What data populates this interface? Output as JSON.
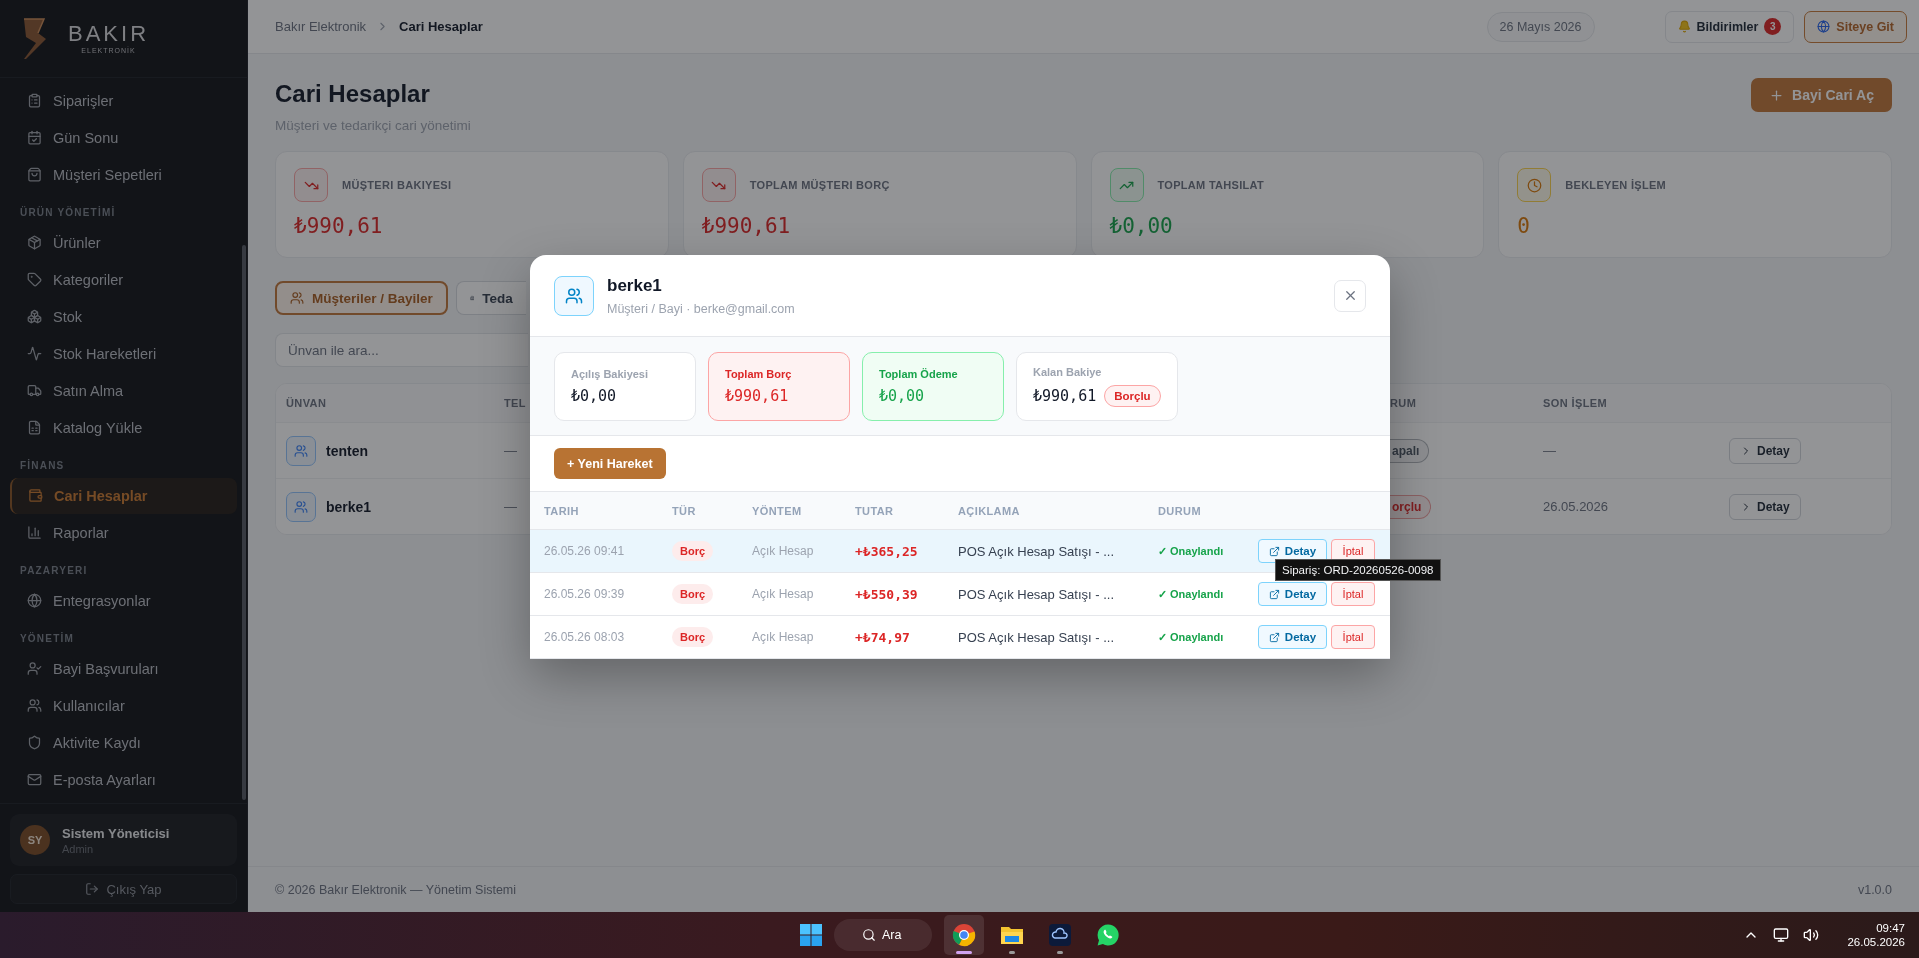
{
  "sidebar": {
    "brand": {
      "name": "BAKIR",
      "tagline": "ELEKTRONİK"
    },
    "sections": [
      {
        "items": [
          {
            "label": "Siparişler",
            "selected": false
          },
          {
            "label": "Gün Sonu",
            "selected": false
          },
          {
            "label": "Müşteri Sepetleri",
            "selected": false
          }
        ]
      },
      {
        "title": "ÜRÜN YÖNETİMİ",
        "items": [
          {
            "label": "Ürünler",
            "selected": false
          },
          {
            "label": "Kategoriler",
            "selected": false
          },
          {
            "label": "Stok",
            "selected": false
          },
          {
            "label": "Stok Hareketleri",
            "selected": false
          },
          {
            "label": "Satın Alma",
            "selected": false
          },
          {
            "label": "Katalog Yükle",
            "selected": false
          }
        ]
      },
      {
        "title": "FİNANS",
        "items": [
          {
            "label": "Cari Hesaplar",
            "selected": true
          },
          {
            "label": "Raporlar",
            "selected": false
          }
        ]
      },
      {
        "title": "PAZARYERI",
        "items": [
          {
            "label": "Entegrasyonlar",
            "selected": false
          }
        ]
      },
      {
        "title": "YÖNETİM",
        "items": [
          {
            "label": "Bayi Başvuruları",
            "selected": false
          },
          {
            "label": "Kullanıcılar",
            "selected": false
          },
          {
            "label": "Aktivite Kaydı",
            "selected": false
          },
          {
            "label": "E-posta Ayarları",
            "selected": false
          }
        ]
      }
    ],
    "user": {
      "initials": "SY",
      "name": "Sistem Yöneticisi",
      "role": "Admin"
    },
    "logout": "Çıkış Yap"
  },
  "header": {
    "breadcrumb": [
      "Bakır Elektronik",
      "Cari Hesaplar"
    ],
    "date": "26 Mayıs 2026",
    "notifications": {
      "label": "Bildirimler",
      "count": "3"
    },
    "site_button": "Siteye Git"
  },
  "page": {
    "title": "Cari Hesaplar",
    "subtitle": "Müşteri ve tedarikçi cari yönetimi",
    "new_button": "Bayi Cari Aç",
    "stats": [
      {
        "kind": "down",
        "label": "MÜŞTERI BAKIYESI",
        "value": "₺990,61"
      },
      {
        "kind": "down",
        "label": "TOPLAM MÜŞTERI BORÇ",
        "value": "₺990,61"
      },
      {
        "kind": "up",
        "label": "TOPLAM TAHSILAT",
        "value": "₺0,00"
      },
      {
        "kind": "pending",
        "label": "BEKLEYEN İŞLEM",
        "value": "0"
      }
    ],
    "tabs": [
      {
        "label": "Müşteriler / Bayiler",
        "selected": true
      },
      {
        "label": "Teda",
        "selected": false
      }
    ],
    "search": {
      "placeholder": "Ünvan ile ara..."
    },
    "table": {
      "columns": [
        "ÜNVAN",
        "TEL",
        "RUM",
        "SON İŞLEM"
      ],
      "rows": [
        {
          "name": "tenten",
          "column_2": "—",
          "kind": "closed",
          "status": "apalı",
          "last": "—",
          "action": "Detay"
        },
        {
          "name": "berke1",
          "column_2": "—",
          "kind": "debt",
          "status": "orçlu",
          "last": "26.05.2026",
          "action": "Detay"
        }
      ]
    }
  },
  "footer": {
    "copyright": "© 2026 Bakır Elektronik — Yönetim Sistemi",
    "version": "v1.0.0"
  },
  "modal": {
    "title": "berke1",
    "subtitle": "Müşteri / Bayi · berke@gmail.com",
    "summary": [
      {
        "kind": "plain",
        "label": "Açılış Bakiyesi",
        "value": "₺0,00"
      },
      {
        "kind": "debt",
        "label": "Toplam Borç",
        "value": "₺990,61"
      },
      {
        "kind": "payment",
        "label": "Toplam Ödeme",
        "value": "₺0,00"
      },
      {
        "kind": "plain",
        "label": "Kalan Bakiye",
        "value": "₺990,61",
        "badge": "Borçlu"
      }
    ],
    "new_button": "+ Yeni Hareket",
    "columns": [
      "TARIH",
      "TÜR",
      "YÖNTEM",
      "TUTAR",
      "AÇIKLAMA",
      "DURUM"
    ],
    "rows": [
      {
        "date": "26.05.26 09:41",
        "type": "Borç",
        "method": "Açık Hesap",
        "amount": "+₺365,25",
        "description": "POS Açık Hesap Satışı - ...",
        "status": "✓ Onaylandı",
        "detail": "Detay",
        "cancel": "İptal",
        "selected": true,
        "tooltip": "Sipariş: ORD-20260526-0098"
      },
      {
        "date": "26.05.26 09:39",
        "type": "Borç",
        "method": "Açık Hesap",
        "amount": "+₺550,39",
        "description": "POS Açık Hesap Satışı - ...",
        "status": "✓ Onaylandı",
        "detail": "Detay",
        "cancel": "İptal",
        "selected": false
      },
      {
        "date": "26.05.26 08:03",
        "type": "Borç",
        "method": "Açık Hesap",
        "amount": "+₺74,97",
        "description": "POS Açık Hesap Satışı - ...",
        "status": "✓ Onaylandı",
        "detail": "Detay",
        "cancel": "İptal",
        "selected": false
      }
    ]
  },
  "taskbar": {
    "search": "Ara",
    "apps": [
      {
        "kind": "browser",
        "selected": true,
        "running": true
      },
      {
        "kind": "files",
        "selected": false,
        "running": true
      },
      {
        "kind": "cloud",
        "selected": false,
        "running": true
      },
      {
        "kind": "chat",
        "selected": false,
        "running": false
      }
    ],
    "time": "09:47",
    "date": "26.05.2026"
  }
}
